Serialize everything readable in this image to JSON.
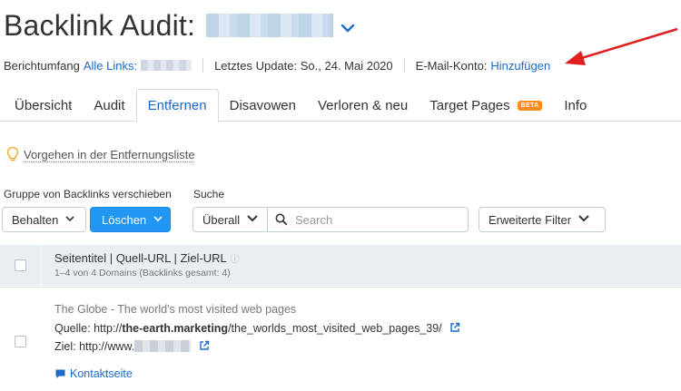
{
  "header": {
    "title": "Backlink Audit:",
    "dropdown_icon": "chevron-down-icon"
  },
  "meta": {
    "scope_label": "Berichtumfang",
    "scope_link": "Alle Links:",
    "update_text": "Letztes Update: So., 24. Mai 2020",
    "email_label": "E-Mail-Konto:",
    "email_link": "Hinzufügen",
    "arrow_color": "#e02020"
  },
  "tabs": [
    {
      "label": "Übersicht"
    },
    {
      "label": "Audit"
    },
    {
      "label": "Entfernen",
      "active": true
    },
    {
      "label": "Disavowen"
    },
    {
      "label": "Verloren & neu"
    },
    {
      "label": "Target Pages",
      "badge": "BETA"
    },
    {
      "label": "Info"
    }
  ],
  "help": {
    "link": "Vorgehen in der Entfernungsliste",
    "icon": "lightbulb-icon"
  },
  "controls": {
    "group_label": "Gruppe von Backlinks verschieben",
    "search_label": "Suche",
    "keep_button": "Behalten",
    "delete_button": "Löschen",
    "scope_select": "Überall",
    "search_placeholder": "Search",
    "filter_button": "Erweiterte Filter"
  },
  "table": {
    "column_title": "Seitentitel | Quell-URL | Ziel-URL",
    "column_info_icon": "info-icon",
    "summary": "1–4 von 4 Domains (Backlinks gesamt: 4)",
    "rows": [
      {
        "title": "The Globe - The world's most visited web pages",
        "source_label": "Quelle:",
        "source_prefix": "http://",
        "source_domain": "the-earth.marketing",
        "source_path": "/the_worlds_most_visited_web_pages_39/",
        "target_label": "Ziel:",
        "target_prefix": "http://www.",
        "contact_link": "Kontaktseite"
      }
    ]
  },
  "colors": {
    "accent": "#1b6ac9",
    "primary_button": "#2196f3",
    "beta_badge": "#ff8c1a",
    "table_header_bg": "#e9eef3"
  }
}
